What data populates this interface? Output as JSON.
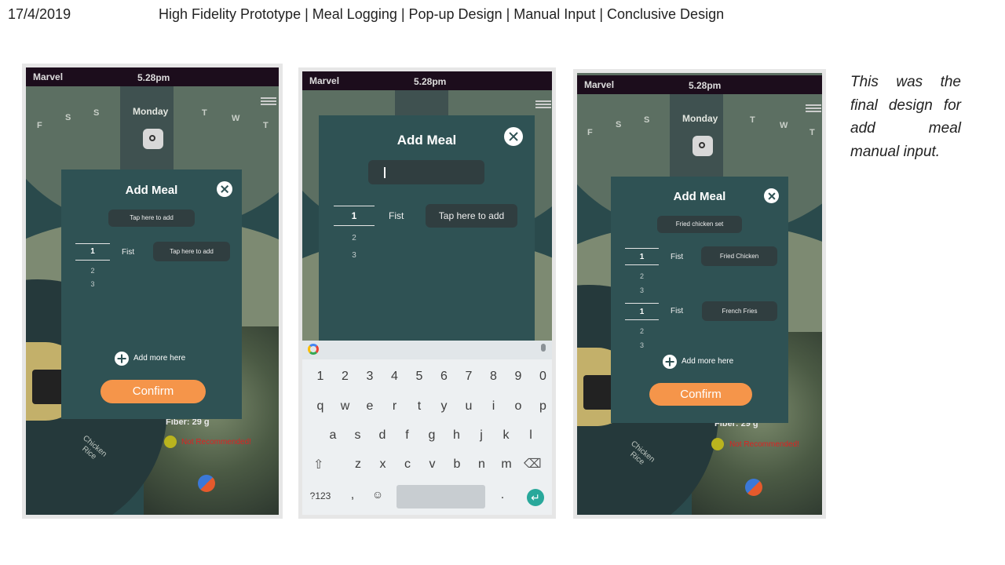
{
  "header": {
    "date": "17/4/2019",
    "title": "High Fidelity Prototype | Meal Logging | Pop-up Design | Manual Input | Conclusive Design"
  },
  "note": "This was the final design for add meal manual input.",
  "status": {
    "carrier": "Marvel",
    "time": "5.28pm"
  },
  "background_app": {
    "days": [
      "F",
      "S",
      "S",
      "Monday",
      "T",
      "W",
      "T"
    ],
    "fiber": "Fiber: 29 g",
    "warning": "Not Recommended!",
    "dish": "Chicken Rice"
  },
  "screen1": {
    "title": "Add Meal",
    "meal_name_placeholder": "Tap here to add",
    "quantity_options": [
      "1",
      "2",
      "3"
    ],
    "unit": "Fist",
    "food_placeholder": "Tap here to add",
    "add_more": "Add more here",
    "confirm": "Confirm"
  },
  "screen2": {
    "title": "Add Meal",
    "quantity_options": [
      "1",
      "2",
      "3"
    ],
    "unit": "Fist",
    "food_placeholder": "Tap here to add",
    "keyboard": {
      "row1": [
        "1",
        "2",
        "3",
        "4",
        "5",
        "6",
        "7",
        "8",
        "9",
        "0"
      ],
      "row2": [
        "q",
        "w",
        "e",
        "r",
        "t",
        "y",
        "u",
        "i",
        "o",
        "p"
      ],
      "row3": [
        "a",
        "s",
        "d",
        "f",
        "g",
        "h",
        "j",
        "k",
        "l"
      ],
      "row4": [
        "z",
        "x",
        "c",
        "v",
        "b",
        "n",
        "m"
      ],
      "symbols": "?123",
      "comma": ",",
      "period": "."
    }
  },
  "screen3": {
    "title": "Add Meal",
    "meal_name": "Fried chicken set",
    "items": [
      {
        "quantity_options": [
          "1",
          "2",
          "3"
        ],
        "unit": "Fist",
        "food": "Fried Chicken"
      },
      {
        "quantity_options": [
          "1",
          "2",
          "3"
        ],
        "unit": "Fist",
        "food": "French Fries"
      }
    ],
    "add_more": "Add more here",
    "confirm": "Confirm"
  },
  "colors": {
    "popup": "#2f5254",
    "confirm": "#f5954a",
    "statusbar": "#1c0d1c",
    "keyboard_enter": "#29a89b"
  }
}
